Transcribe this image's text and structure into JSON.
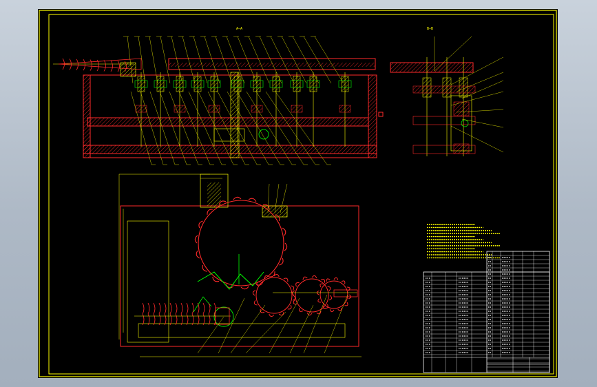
{
  "drawing": {
    "background": "#000000",
    "colors": {
      "frame": "#ffff00",
      "outline": "#ff2a2a",
      "hatch": "#ff2a2a",
      "leader": "#ffff00",
      "center_line": "#ffffff",
      "green": "#00ff00",
      "table_text": "#ffffff"
    }
  },
  "views": {
    "top_section_caption": "A—A",
    "side_section_caption": "B—B"
  }
}
